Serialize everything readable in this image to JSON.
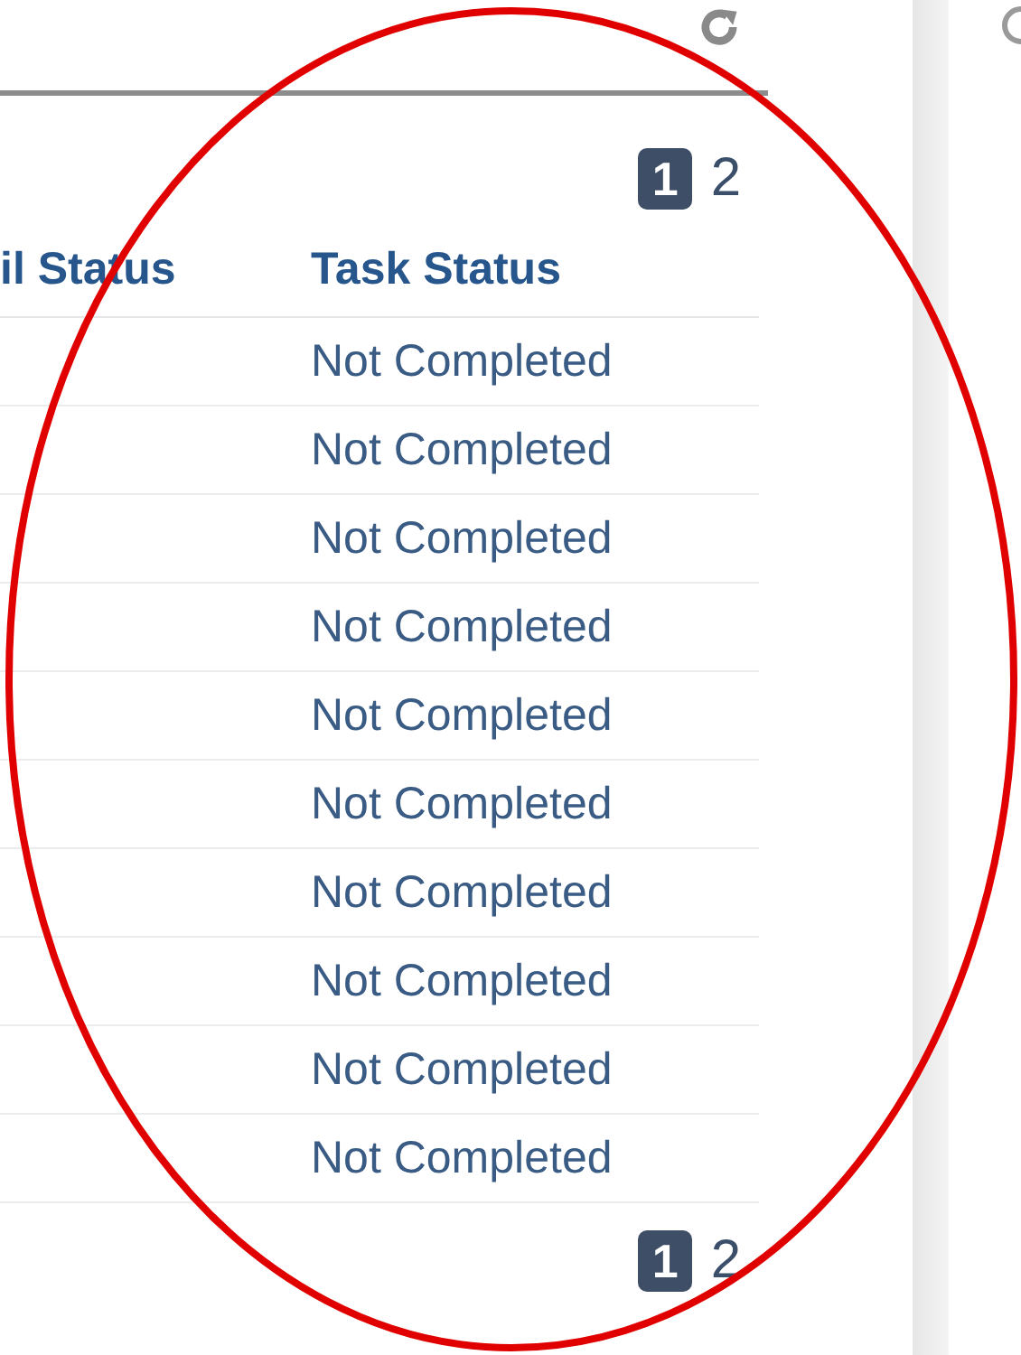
{
  "pagination_top": [
    {
      "label": "1",
      "selected": true
    },
    {
      "label": "2",
      "selected": false
    }
  ],
  "table": {
    "columns": [
      "il Status",
      "Task Status"
    ],
    "rows": [
      {
        "task_status": "Not Completed"
      },
      {
        "task_status": "Not Completed"
      },
      {
        "task_status": "Not Completed"
      },
      {
        "task_status": "Not Completed"
      },
      {
        "task_status": "Not Completed"
      },
      {
        "task_status": "Not Completed"
      },
      {
        "task_status": "Not Completed"
      },
      {
        "task_status": "Not Completed"
      },
      {
        "task_status": "Not Completed"
      },
      {
        "task_status": "Not Completed"
      }
    ]
  },
  "pagination_bottom": [
    {
      "label": "1",
      "selected": true
    },
    {
      "label": "2",
      "selected": false
    }
  ]
}
